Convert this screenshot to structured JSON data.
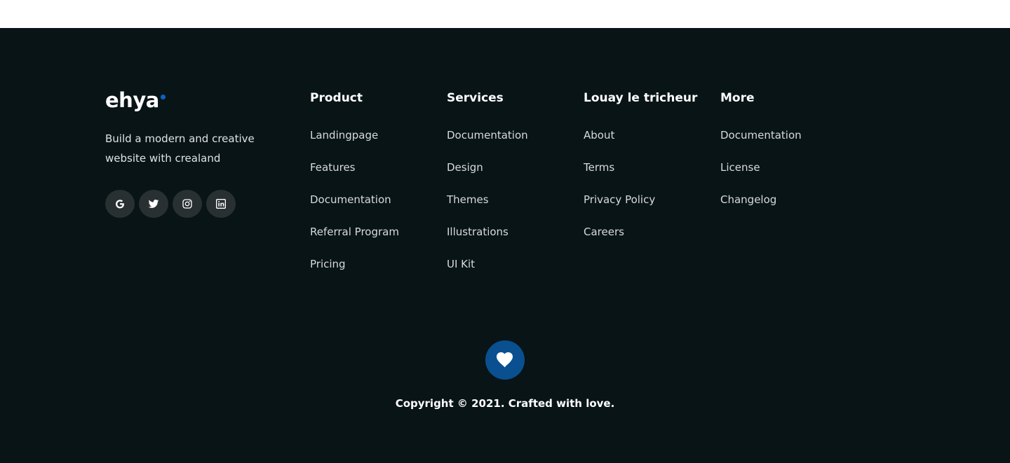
{
  "brand": {
    "logo_text": "ehya",
    "tagline": "Build a modern and creative website with crealand",
    "accent_color": "#0a63c9"
  },
  "socials": [
    {
      "icon": "google-icon"
    },
    {
      "icon": "twitter-icon"
    },
    {
      "icon": "instagram-icon"
    },
    {
      "icon": "linkedin-icon"
    }
  ],
  "columns": [
    {
      "title": "Product",
      "links": [
        "Landingpage",
        "Features",
        "Documentation",
        "Referral Program",
        "Pricing"
      ]
    },
    {
      "title": "Services",
      "links": [
        "Documentation",
        "Design",
        "Themes",
        "Illustrations",
        "UI Kit"
      ]
    },
    {
      "title": "Louay le tricheur",
      "links": [
        "About",
        "Terms",
        "Privacy Policy",
        "Careers"
      ]
    },
    {
      "title": "More",
      "links": [
        "Documentation",
        "License",
        "Changelog"
      ]
    }
  ],
  "footer_bottom": {
    "heart_icon": "heart-icon",
    "heart_color": "#0a4f8f",
    "copyright": "Copyright © 2021. Crafted with love."
  },
  "colors": {
    "background": "#091416",
    "social_bg": "#283032"
  }
}
